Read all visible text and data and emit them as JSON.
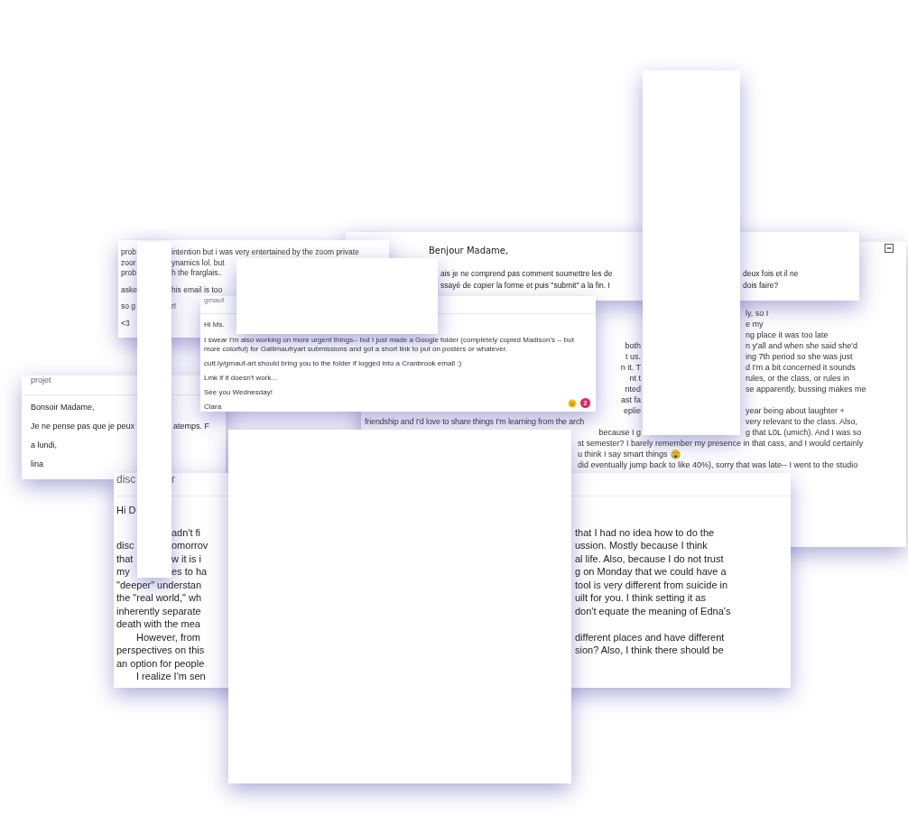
{
  "excerpt_email": {
    "rows": [
      {
        "left": "prob",
        "right": "intention but i was very entertained by the zoom private"
      },
      {
        "left": "zoor",
        "right": "ynamics lol. but"
      },
      {
        "left": "prob",
        "right": "h the frarglais.."
      },
      {
        "left": "aske",
        "right": "his email is too"
      },
      {
        "left": "so g",
        "right": "r!"
      },
      {
        "left": "<3"
      }
    ]
  },
  "benjour_email": {
    "greeting": "Benjour Madame,",
    "rows": [
      {
        "left": "ais je ne comprend pas comment soumettre les de",
        "right": "deux fois et il ne"
      },
      {
        "left": "ssayé de copier la forme et puis \"submit\" a la fin. I",
        "right": "dois faire?"
      }
    ]
  },
  "long_email": {
    "rows": [
      {
        "kind": "split",
        "right": "ly, so I"
      },
      {
        "kind": "split",
        "right": "e my"
      },
      {
        "kind": "split",
        "right": "ng place it was too late"
      },
      {
        "kind": "split",
        "left": "both",
        "right": "n y'all and when she said she'd"
      },
      {
        "kind": "split",
        "left": "t us.",
        "right": "ing 7th period so she was just"
      },
      {
        "kind": "split",
        "left": "n it. T",
        "right": "d I'm a bit concerned it sounds"
      },
      {
        "kind": "split",
        "left": "nt t",
        "right": "rules, or the class, or rules in"
      },
      {
        "kind": "split",
        "left": "nted",
        "right": "se apparently, bussing makes me"
      },
      {
        "kind": "split",
        "left": "ast fa"
      },
      {
        "kind": "split",
        "left": "eplie",
        "right": "year being about laughter +"
      },
      {
        "kind": "wide",
        "left": "friendship and I'd love to share things I'm learning from the arch",
        "right": "very relevant to the class. Also,"
      },
      {
        "kind": "split",
        "left": "because I g",
        "right": "g that L0L (umich). And I was so"
      },
      {
        "kind": "tail",
        "left": "st semester? I barely remember my presence in that cass, and I would certainly"
      },
      {
        "kind": "tail_emoji",
        "left": "u think I say smart things"
      },
      {
        "kind": "tail",
        "left": "did eventually jump back to like 40%), sorry that was late-- I went to the studio"
      }
    ]
  },
  "gmail_email": {
    "subject": "gmauf",
    "greeting": "Hi Ms.",
    "paragraphs": [
      "I swear I'm also working on more urgent things-- but I just made a Google folder (completely copied Madison's -- but more colorful) for Gallimaufryart submissions and got a short link to put on posters or whatever.",
      "cutt.ly/gmauf-art should bring you to the folder if logged into a Cranbrook email :)",
      "Lmk if it doesn't work...",
      "See you Wednesday!",
      "Clara"
    ],
    "reaction_count": "2"
  },
  "projet_email": {
    "subject": "projet",
    "lines": [
      {
        "left": "Bonsoir Madame,"
      },
      {
        "left": "Je ne pense pas que je peux",
        "right": "atemps. F"
      },
      {
        "left": "a lundi,"
      },
      {
        "left": "lina"
      }
    ]
  },
  "essay_email": {
    "subject": {
      "left": "disc",
      "middle": "r"
    },
    "greeting": "Hi D",
    "rows": [
      {
        "middle": "adn't fi",
        "right": "that I had no idea how to do the"
      },
      {
        "left": "disc",
        "middle": "omorrov",
        "right": "ussion. Mostly because I think"
      },
      {
        "left": "that",
        "middle": "w it is i",
        "right": "al life. Also, because I do not trust"
      },
      {
        "left": "my",
        "middle": "es to ha",
        "right": "g on Monday that we could have a"
      },
      {
        "left": "\"deeper\" understan",
        "right": "tool is very different from suicide in",
        "indented": false
      },
      {
        "left": "the \"real world,\" wh",
        "right": "uilt for you. I think setting it as",
        "indented": false
      },
      {
        "left": "inherently separate",
        "right": "don't equate the meaning of Edna's",
        "indented": false
      },
      {
        "left": "death with the mea",
        "indented": false
      },
      {
        "left": "However, from",
        "right": "different places and have different",
        "indented": true
      },
      {
        "left": "perspectives on this",
        "right": "sion? Also, I think there should be",
        "indented": false
      },
      {
        "left": "an option for people",
        "indented": false
      },
      {
        "left": "I realize I'm sen",
        "indented": true
      }
    ]
  }
}
